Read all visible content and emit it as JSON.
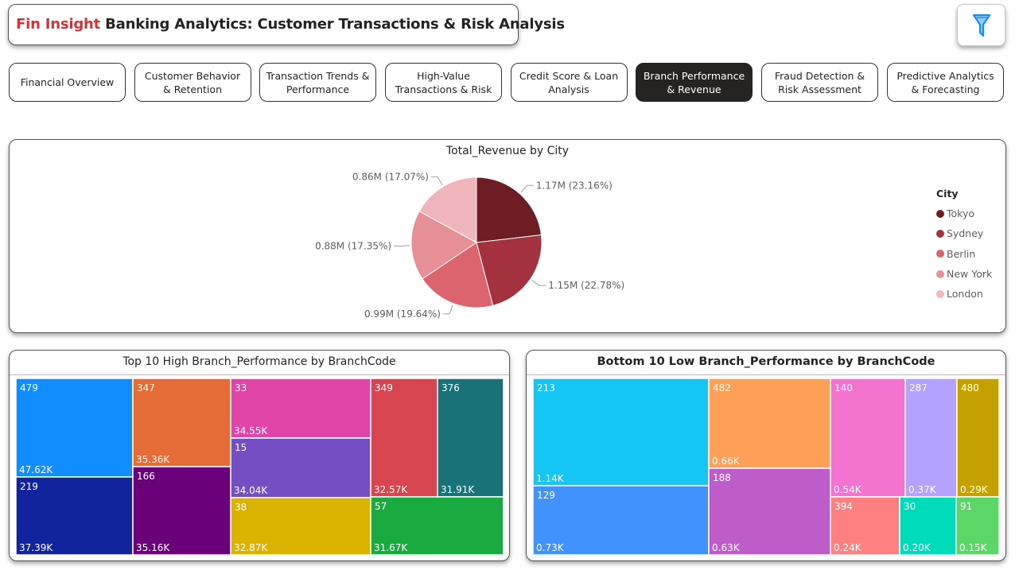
{
  "header": {
    "brand": "Fin Insight",
    "title": " Banking Analytics: Customer Transactions & Risk Analysis",
    "filter_icon": "filter-funnel-icon"
  },
  "tabs": [
    {
      "label": "Financial Overview",
      "active": false
    },
    {
      "label": "Customer Behavior & Retention",
      "active": false
    },
    {
      "label": "Transaction Trends & Performance",
      "active": false
    },
    {
      "label": "High-Value Transactions & Risk",
      "active": false
    },
    {
      "label": "Credit Score & Loan Analysis",
      "active": false
    },
    {
      "label": "Branch Performance & Revenue",
      "active": true
    },
    {
      "label": "Fraud Detection & Risk Assessment",
      "active": false
    },
    {
      "label": "Predictive Analytics & Forecasting",
      "active": false
    }
  ],
  "chart_data": [
    {
      "type": "pie",
      "title": "Total_Revenue by City",
      "legend_title": "City",
      "legend_position": "right",
      "slices": [
        {
          "name": "Tokyo",
          "value_label": "1.17M",
          "percent": 23.16,
          "label": "1.17M (23.16%)",
          "color": "#6f1d24"
        },
        {
          "name": "Sydney",
          "value_label": "1.15M",
          "percent": 22.78,
          "label": "1.15M (22.78%)",
          "color": "#a3323e"
        },
        {
          "name": "Berlin",
          "value_label": "0.99M",
          "percent": 19.64,
          "label": "0.99M (19.64%)",
          "color": "#dc646e"
        },
        {
          "name": "New York",
          "value_label": "0.88M",
          "percent": 17.35,
          "label": "0.88M (17.35%)",
          "color": "#e78f96"
        },
        {
          "name": "London",
          "value_label": "0.86M",
          "percent": 17.07,
          "label": "0.86M (17.07%)",
          "color": "#f0b6bb"
        }
      ]
    },
    {
      "type": "treemap",
      "title": "Top 10 High Branch_Performance by BranchCode",
      "items": [
        {
          "code": "479",
          "value": "47.62K",
          "color": "#118dff"
        },
        {
          "code": "219",
          "value": "37.39K",
          "color": "#12239e"
        },
        {
          "code": "347",
          "value": "35.36K",
          "color": "#e66c37"
        },
        {
          "code": "166",
          "value": "35.16K",
          "color": "#6b007b"
        },
        {
          "code": "33",
          "value": "34.55K",
          "color": "#e044a7"
        },
        {
          "code": "15",
          "value": "34.04K",
          "color": "#744ec2"
        },
        {
          "code": "38",
          "value": "32.87K",
          "color": "#d9b300"
        },
        {
          "code": "349",
          "value": "32.57K",
          "color": "#d64550"
        },
        {
          "code": "376",
          "value": "31.91K",
          "color": "#197278"
        },
        {
          "code": "57",
          "value": "31.67K",
          "color": "#1aab40"
        }
      ]
    },
    {
      "type": "treemap",
      "title": "Bottom 10 Low Branch_Performance by BranchCode",
      "items": [
        {
          "code": "213",
          "value": "1.14K",
          "color": "#15c6f4"
        },
        {
          "code": "129",
          "value": "0.73K",
          "color": "#4092ff"
        },
        {
          "code": "482",
          "value": "0.66K",
          "color": "#ffa058"
        },
        {
          "code": "188",
          "value": "0.63K",
          "color": "#be5dc9"
        },
        {
          "code": "140",
          "value": "0.54K",
          "color": "#f472d0"
        },
        {
          "code": "394",
          "value": "0.24K",
          "color": "#ff8080"
        },
        {
          "code": "30",
          "value": "0.20K",
          "color": "#00dbbc"
        },
        {
          "code": "287",
          "value": "0.37K",
          "color": "#b5a1ff"
        },
        {
          "code": "480",
          "value": "0.29K",
          "color": "#c5a100"
        },
        {
          "code": "91",
          "value": "0.15K",
          "color": "#5bd667"
        }
      ]
    }
  ]
}
